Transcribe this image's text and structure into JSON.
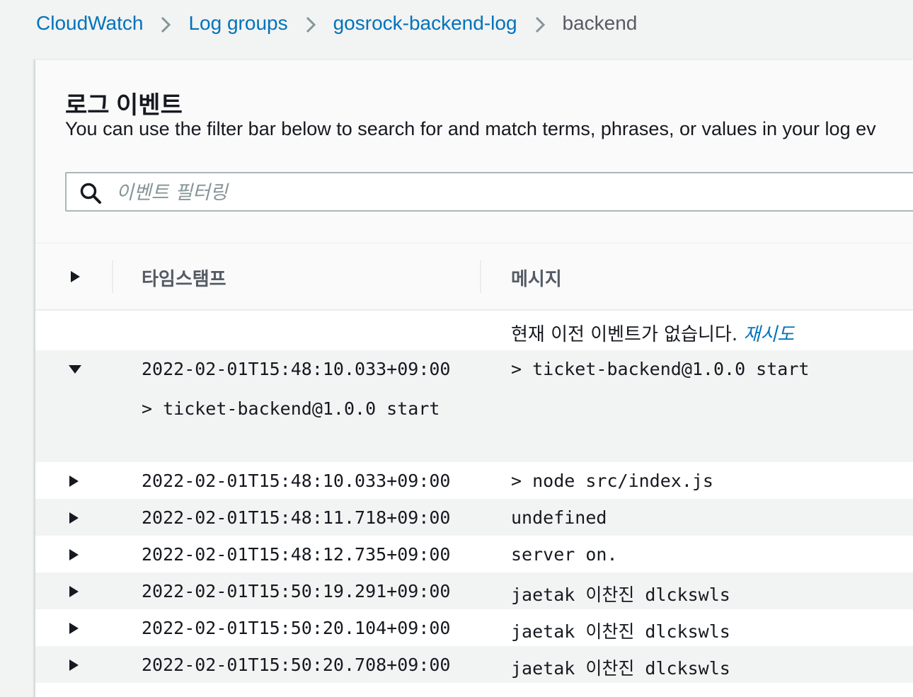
{
  "breadcrumb": {
    "items": [
      "CloudWatch",
      "Log groups",
      "gosrock-backend-log"
    ],
    "current": "backend"
  },
  "header": {
    "title": "로그 이벤트",
    "description": "You can use the filter bar below to search for and match terms, phrases, or values in your log ev"
  },
  "search": {
    "placeholder": "이벤트 필터링",
    "value": ""
  },
  "table": {
    "columns": [
      "타임스탬프",
      "메시지"
    ],
    "no_events_text": "현재 이전 이벤트가 없습니다.",
    "retry_label": "재시도",
    "rows": [
      {
        "timestamp": "2022-02-01T15:48:10.033+09:00",
        "message": "> ticket-backend@1.0.0 start",
        "expanded": true,
        "detail": "> ticket-backend@1.0.0 start"
      },
      {
        "timestamp": "2022-02-01T15:48:10.033+09:00",
        "message": "> node src/index.js",
        "expanded": false
      },
      {
        "timestamp": "2022-02-01T15:48:11.718+09:00",
        "message": "undefined",
        "expanded": false
      },
      {
        "timestamp": "2022-02-01T15:48:12.735+09:00",
        "message": "server on.",
        "expanded": false
      },
      {
        "timestamp": "2022-02-01T15:50:19.291+09:00",
        "message": "jaetak 이찬진 dlckswls",
        "expanded": false
      },
      {
        "timestamp": "2022-02-01T15:50:20.104+09:00",
        "message": "jaetak 이찬진 dlckswls",
        "expanded": false
      },
      {
        "timestamp": "2022-02-01T15:50:20.708+09:00",
        "message": "jaetak 이찬진 dlckswls",
        "expanded": false
      }
    ]
  },
  "icons": {
    "search": "search-icon",
    "expand": "caret-right-icon",
    "collapse": "caret-down-icon",
    "separator": "chevron-right-icon"
  },
  "colors": {
    "link": "#0073bb",
    "text": "#16191f",
    "muted": "#545b64",
    "background": "#f2f3f3"
  }
}
